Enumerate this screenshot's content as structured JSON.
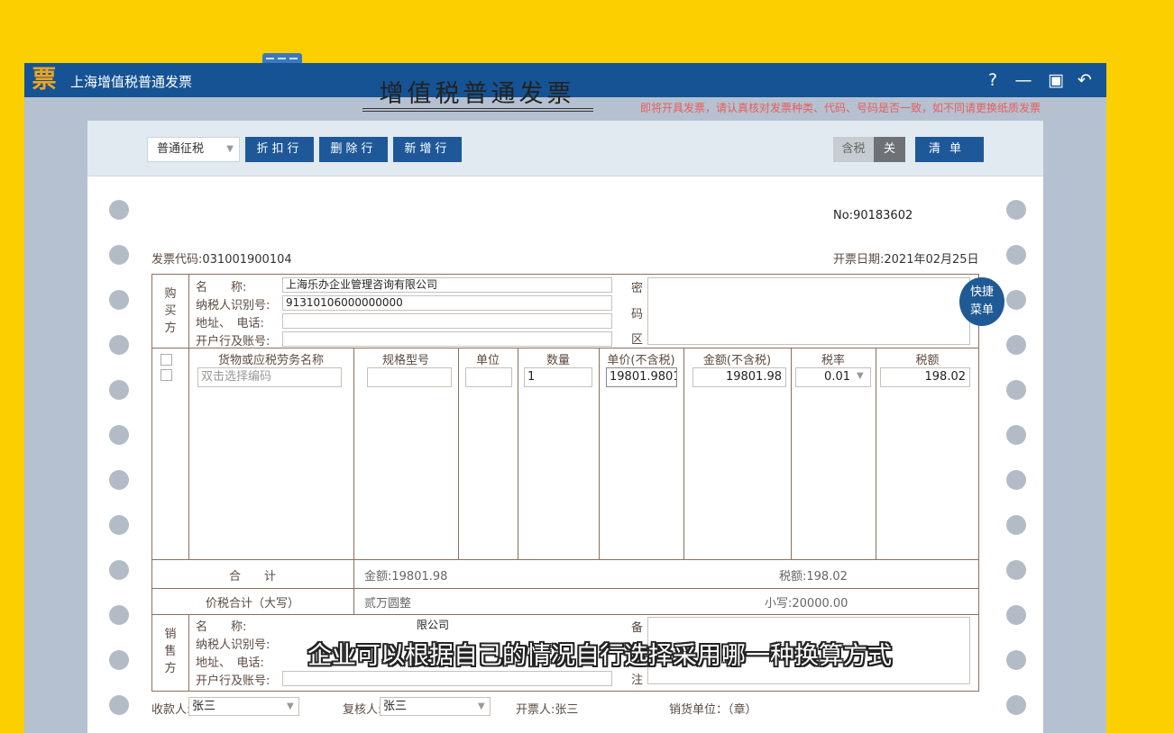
{
  "window": {
    "logo_char": "票",
    "title": "上海增值税普通发票",
    "controls": {
      "help": "?",
      "minimize": "—",
      "restore": "▣",
      "back": "↶"
    }
  },
  "warning": "即将开具发票，请认真核对发票种类、代码、号码是否一致，如不同请更换纸质发票",
  "toolbar": {
    "tax_type": "普通征税",
    "discount_row": "折扣行",
    "delete_row": "删除行",
    "add_row": "新增行",
    "tax_included": "含税",
    "toggle_off": "关",
    "list": "清单"
  },
  "invoice": {
    "title": "增值税普通发票",
    "number_label": "No:",
    "number": "90183602",
    "code_label": "发票代码:",
    "code": "031001900104",
    "date_label": "开票日期:",
    "date": "2021年02月25日"
  },
  "buyer": {
    "side_label": "购\n买\n方",
    "name_label": "名　　称:",
    "name": "上海乐办企业管理咨询有限公司",
    "tax_id_label": "纳税人识别号:",
    "tax_id": "91310106000000000",
    "addr_label": "地址、　电话:",
    "addr": "",
    "bank_label": "开户行及账号:",
    "bank": ""
  },
  "password_area": {
    "c1": "密",
    "c2": "码",
    "c3": "区"
  },
  "quick_menu": {
    "line1": "快捷",
    "line2": "菜单"
  },
  "items": {
    "headers": [
      "货物或应税劳务名称",
      "规格型号",
      "单位",
      "数量",
      "单价(不含税)",
      "金额(不含税)",
      "税率",
      "税额"
    ],
    "row": {
      "name_placeholder": "双击选择编码",
      "spec": "",
      "unit": "",
      "quantity": "1",
      "price": "19801.9801",
      "amount": "19801.98",
      "rate": "0.01",
      "tax": "198.02"
    }
  },
  "totals": {
    "label": "合　　计",
    "amount": "金额:19801.98",
    "tax": "税额:198.02",
    "sum_label": "价税合计（大写）",
    "sum_words": "贰万圆整",
    "sum_small": "小写:20000.00"
  },
  "seller": {
    "side_label": "销\n售\n方",
    "name_label": "名　　称:",
    "name_partial": "限公司",
    "tax_id_label": "纳税人识别号:",
    "addr_label": "地址、　电话:",
    "bank_label": "开户行及账号:",
    "remark_c1": "备",
    "remark_c2": "注"
  },
  "footer": {
    "payee_label": "收款人:",
    "payee": "张三",
    "reviewer_label": "复核人:",
    "reviewer": "张三",
    "issuer": "开票人:张三",
    "seller_unit": "销货单位：（章）"
  },
  "subtitle": "企业可以根据自己的情况自行选择采用哪一种换算方式"
}
